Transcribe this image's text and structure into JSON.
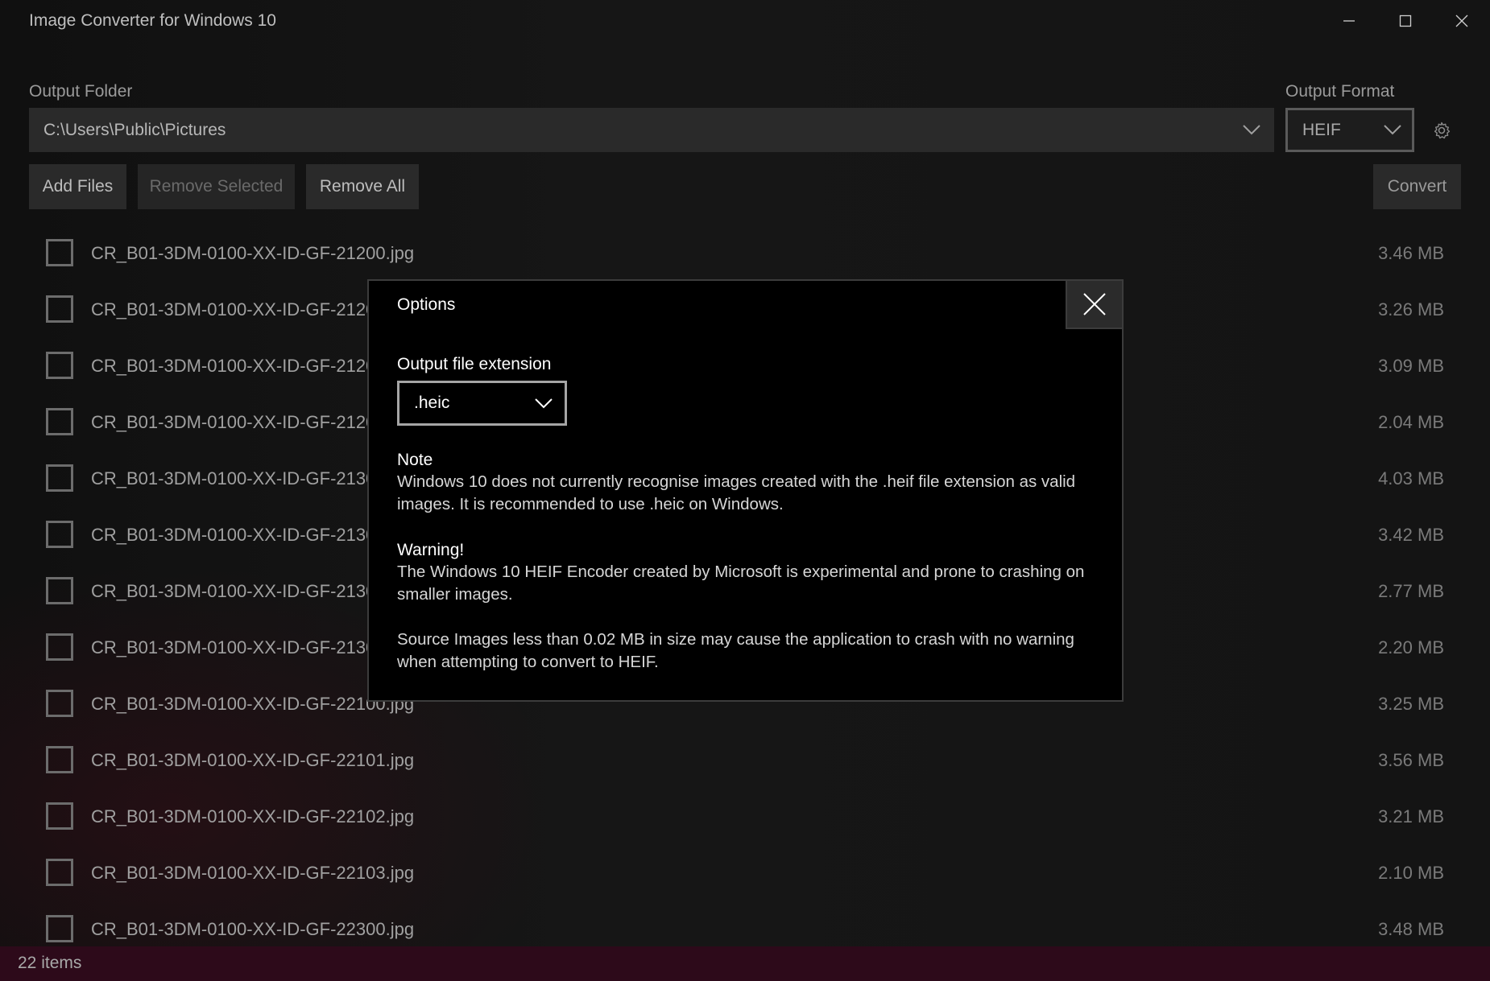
{
  "app": {
    "title": "Image Converter for Windows 10"
  },
  "output_folder": {
    "label": "Output Folder",
    "value": "C:\\Users\\Public\\Pictures"
  },
  "output_format": {
    "label": "Output Format",
    "value": "HEIF"
  },
  "toolbar": {
    "add_files": "Add Files",
    "remove_selected": "Remove Selected",
    "remove_all": "Remove All",
    "convert": "Convert"
  },
  "files": [
    {
      "name": "CR_B01-3DM-0100-XX-ID-GF-21200.jpg",
      "size": "3.46 MB"
    },
    {
      "name": "CR_B01-3DM-0100-XX-ID-GF-2120",
      "size": "3.26 MB"
    },
    {
      "name": "CR_B01-3DM-0100-XX-ID-GF-2120",
      "size": "3.09 MB"
    },
    {
      "name": "CR_B01-3DM-0100-XX-ID-GF-2120",
      "size": "2.04 MB"
    },
    {
      "name": "CR_B01-3DM-0100-XX-ID-GF-2130",
      "size": "4.03 MB"
    },
    {
      "name": "CR_B01-3DM-0100-XX-ID-GF-2130",
      "size": "3.42 MB"
    },
    {
      "name": "CR_B01-3DM-0100-XX-ID-GF-2130",
      "size": "2.77 MB"
    },
    {
      "name": "CR_B01-3DM-0100-XX-ID-GF-2130",
      "size": "2.20 MB"
    },
    {
      "name": "CR_B01-3DM-0100-XX-ID-GF-22100.jpg",
      "size": "3.25 MB"
    },
    {
      "name": "CR_B01-3DM-0100-XX-ID-GF-22101.jpg",
      "size": "3.56 MB"
    },
    {
      "name": "CR_B01-3DM-0100-XX-ID-GF-22102.jpg",
      "size": "3.21 MB"
    },
    {
      "name": "CR_B01-3DM-0100-XX-ID-GF-22103.jpg",
      "size": "2.10 MB"
    },
    {
      "name": "CR_B01-3DM-0100-XX-ID-GF-22300.jpg",
      "size": "3.48 MB"
    }
  ],
  "status": {
    "items": "22 items"
  },
  "dialog": {
    "title": "Options",
    "ext_label": "Output file extension",
    "ext_value": ".heic",
    "note_heading": "Note",
    "note_text": "Windows 10 does not currently recognise images created with the .heif file extension as valid images. It is recommended to use .heic on Windows.",
    "warning_heading": "Warning!",
    "warning_text": "The Windows 10 HEIF Encoder created by Microsoft is experimental and prone to crashing on smaller images.",
    "source_text": "Source Images less than 0.02 MB in size may cause the application to crash with no warning when attempting to convert to HEIF."
  },
  "colors": {
    "status_bar": "#2d0a1a",
    "dialog_bg": "#000000"
  }
}
